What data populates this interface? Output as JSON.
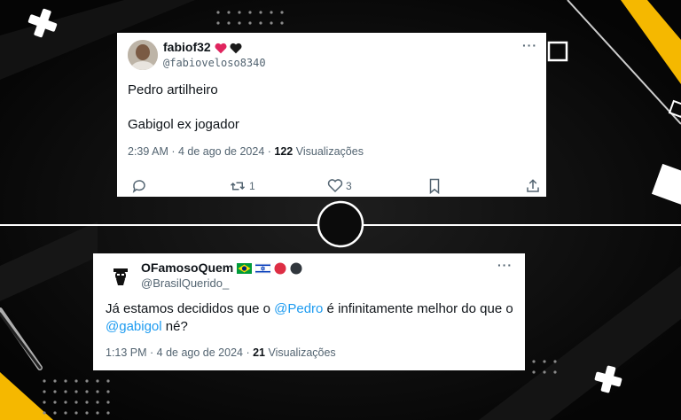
{
  "colors": {
    "background": "#0b0b0b",
    "accent_yellow": "#f5b800",
    "link_blue": "#1d9bf0",
    "heart_red": "#e0245e",
    "muted_text": "#536471"
  },
  "tweet1": {
    "display_name": "fabiof32",
    "name_emojis": [
      "red-heart-icon",
      "black-heart-icon"
    ],
    "handle": "@fabioveloso8340",
    "line1": "Pedro artilheiro",
    "line2": "Gabigol ex jogador",
    "time": "2:39 AM · 4 de ago de 2024 · ",
    "views_count": "122",
    "views_label": " Visualizações",
    "retweets": "1",
    "likes": "3"
  },
  "tweet2": {
    "display_name": "OFamosoQuem",
    "name_emojis": [
      "brazil-flag-icon",
      "israel-flag-icon",
      "red-circle-icon",
      "black-circle-icon"
    ],
    "handle": "@BrasilQuerido_",
    "text_a": "Já estamos decididos que o ",
    "mention1": "@Pedro",
    "text_b": " é infinitamente melhor do que o",
    "mention2": "@gabigol",
    "text_c": "  né?",
    "time": "1:13 PM · 4 de ago de 2024 · ",
    "views_count": "21",
    "views_label": " Visualizações"
  }
}
